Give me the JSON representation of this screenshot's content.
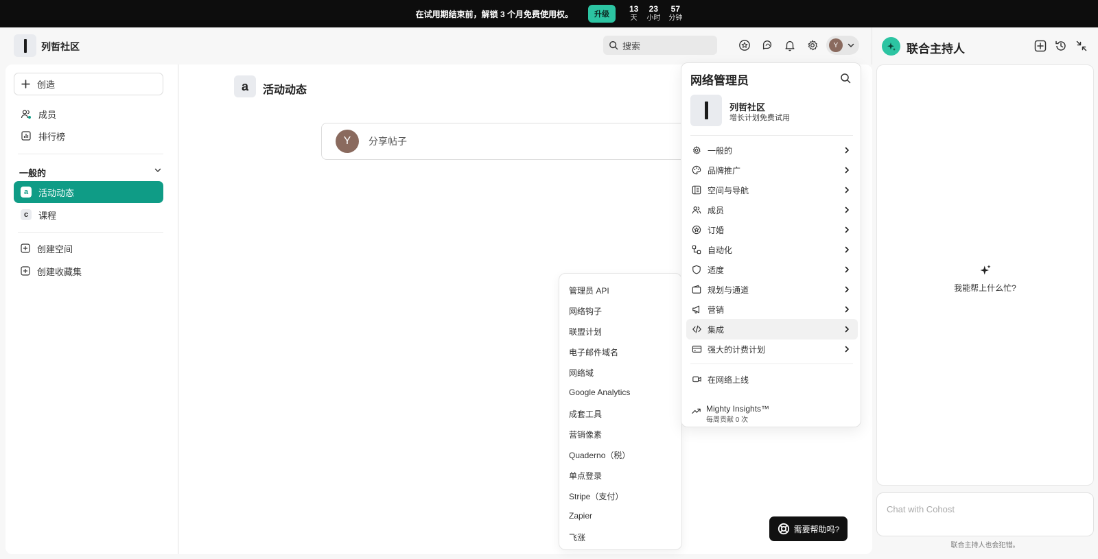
{
  "banner": {
    "text": "在试用期结束前，解锁 3 个月免费使用权。",
    "upgrade_label": "升级",
    "countdown": [
      {
        "num": "13",
        "label": "天"
      },
      {
        "num": "23",
        "label": "小时"
      },
      {
        "num": "57",
        "label": "分钟"
      }
    ]
  },
  "header": {
    "site_name": "列哲社区",
    "search_placeholder": "搜索",
    "avatar_letter": "Y"
  },
  "sidebar": {
    "create_label": "创造",
    "items": [
      {
        "label": "成员"
      },
      {
        "label": "排行榜"
      }
    ],
    "section_label": "一般的",
    "spaces": [
      {
        "letter": "a",
        "label": "活动动态"
      },
      {
        "letter": "c",
        "label": "课程"
      }
    ],
    "actions": [
      {
        "label": "创建空间"
      },
      {
        "label": "创建收藏集"
      }
    ]
  },
  "main": {
    "feed_letter": "a",
    "feed_title": "活动动态",
    "compose_avatar": "Y",
    "compose_placeholder": "分享帖子"
  },
  "submenu": {
    "items": [
      "管理员 API",
      "网络钩子",
      "联盟计划",
      "电子邮件域名",
      "网络域",
      "Google Analytics",
      "成套工具",
      "营销像素",
      "Quaderno（税）",
      "单点登录",
      "Stripe（支付）",
      "Zapier",
      "飞涨"
    ]
  },
  "admin": {
    "title": "网络管理员",
    "community_name": "列哲社区",
    "plan": "增长计划免费试用",
    "items": [
      {
        "label": "一般的",
        "icon": "gear-icon"
      },
      {
        "label": "品牌推广",
        "icon": "palette-icon"
      },
      {
        "label": "空间与导航",
        "icon": "layout-icon"
      },
      {
        "label": "成员",
        "icon": "users-icon"
      },
      {
        "label": "订婚",
        "icon": "star-badge-icon"
      },
      {
        "label": "自动化",
        "icon": "automation-icon"
      },
      {
        "label": "适度",
        "icon": "shield-icon"
      },
      {
        "label": "规划与通道",
        "icon": "wallet-icon"
      },
      {
        "label": "营销",
        "icon": "megaphone-icon"
      },
      {
        "label": "集成",
        "icon": "code-icon"
      },
      {
        "label": "强大的计费计划",
        "icon": "credit-card-icon"
      }
    ],
    "go_live": "在网络上线",
    "insights_title": "Mighty Insights™",
    "insights_sub": "每周贡献 0 次"
  },
  "help_label": "需要帮助吗?",
  "cohost": {
    "title": "联合主持人",
    "empty_text": "我能帮上什么忙?",
    "input_placeholder": "Chat with Cohost",
    "note": "联合主持人也会犯错。"
  },
  "colors": {
    "accent": "#0f9c86",
    "upgrade": "#2cc4a2",
    "banner_bg": "#0d0d0d"
  }
}
